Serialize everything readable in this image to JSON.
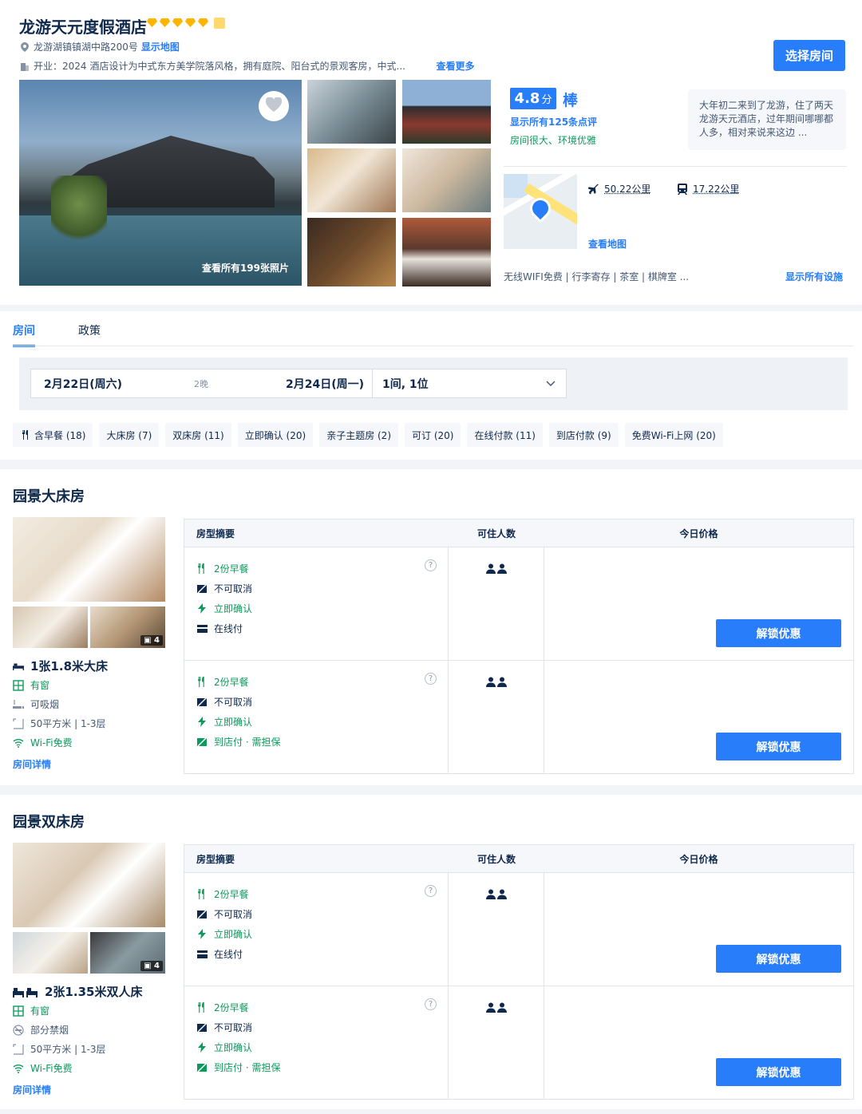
{
  "hotel": {
    "name": "龙游天元度假酒店",
    "address": "龙游湖镇镇湖中路200号",
    "show_map": "显示地图",
    "opened_label": "开业：2024",
    "description": "酒店设计为中式东方美学院落风格，拥有庭院、阳台式的景观客房，中式...",
    "see_more": "查看更多",
    "select_room": "选择房间",
    "all_photos": "查看所有199张照片",
    "score": "4.8",
    "score_unit": "分",
    "score_word": "棒",
    "reviews_link": "显示所有125条点评",
    "review_tags": "房间很大、环境优雅",
    "quote": "大年初二来到了龙游，住了两天龙游天元酒店，过年期间哪哪都人多，相对来说来这边 ...",
    "airport_distance": "50.22公里",
    "station_distance": "17.22公里",
    "view_map": "查看地图",
    "facilities": "无线WIFI免费 | 行李寄存 | 茶室 | 棋牌室 ...",
    "all_facilities": "显示所有设施",
    "star_color": "#ffb400"
  },
  "tabs": [
    "房间",
    "政策"
  ],
  "search": {
    "checkin": "2月22日(周六)",
    "nights": "2晚",
    "checkout": "2月24日(周一)",
    "guests": "1间, 1位"
  },
  "filters": [
    "含早餐 (18)",
    "大床房 (7)",
    "双床房 (11)",
    "立即确认 (20)",
    "亲子主题房 (2)",
    "可订 (20)",
    "在线付款 (11)",
    "到店付款 (9)",
    "免费Wi-Fi上网 (20)"
  ],
  "table_headers": {
    "summary": "房型摘要",
    "capacity": "可住人数",
    "price": "今日价格"
  },
  "rooms": [
    {
      "title": "园景大床房",
      "photo_count": "4",
      "bed": "1张1.8米大床",
      "window": "有窗",
      "smoking": "可吸烟",
      "area": "50平方米 | 1-3层",
      "wifi": "Wi-Fi免费",
      "details": "房间详情",
      "rates": [
        {
          "breakfast": "2份早餐",
          "cancel": "不可取消",
          "confirm": "立即确认",
          "payment": "在线付",
          "pay_green": false,
          "button": "解锁优惠"
        },
        {
          "breakfast": "2份早餐",
          "cancel": "不可取消",
          "confirm": "立即确认",
          "payment": "到店付 · 需担保",
          "pay_green": true,
          "button": "解锁优惠"
        }
      ]
    },
    {
      "title": "园景双床房",
      "photo_count": "4",
      "bed": "2张1.35米双人床",
      "window": "有窗",
      "smoking": "部分禁烟",
      "area": "50平方米 | 1-3层",
      "wifi": "Wi-Fi免费",
      "details": "房间详情",
      "rates": [
        {
          "breakfast": "2份早餐",
          "cancel": "不可取消",
          "confirm": "立即确认",
          "payment": "在线付",
          "pay_green": false,
          "button": "解锁优惠"
        },
        {
          "breakfast": "2份早餐",
          "cancel": "不可取消",
          "confirm": "立即确认",
          "payment": "到店付 · 需担保",
          "pay_green": true,
          "button": "解锁优惠"
        }
      ]
    }
  ]
}
